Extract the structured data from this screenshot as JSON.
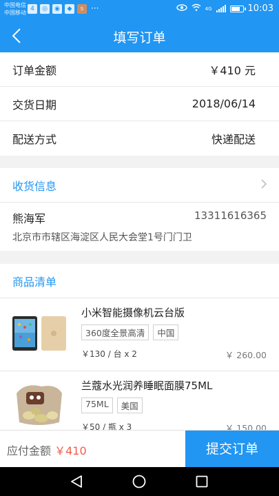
{
  "status_bar": {
    "carrier_line1": "中国电信",
    "carrier_line2": "中国移动",
    "network": "4G",
    "time": "10:03",
    "more": "···"
  },
  "nav": {
    "back_icon": "chevron-left-icon",
    "title": "填写订单"
  },
  "order": {
    "amount_label": "订单金额",
    "amount_value": "￥410 元",
    "date_label": "交货日期",
    "date_value": "2018/06/14",
    "delivery_label": "配送方式",
    "delivery_value": "快递配送"
  },
  "shipping": {
    "title": "收货信息",
    "name": "熊海军",
    "phone": "13311616365",
    "address": "北京市市辖区海淀区人民大会堂1号门门卫"
  },
  "goods": {
    "title": "商品清单",
    "items": [
      {
        "title": "小米智能摄像机云台版",
        "tags": [
          "360度全景高清",
          "中国"
        ],
        "unit": "￥130 / 台 x 2",
        "price": "￥ 260.00"
      },
      {
        "title": "兰蔻水光润养睡眠面膜75ML",
        "tags": [
          "75ML",
          "美国"
        ],
        "unit": "￥50 / 瓶 x 3",
        "price": "￥ 150.00"
      }
    ]
  },
  "footer": {
    "pay_label": "应付金额",
    "pay_amount": "￥410",
    "submit": "提交订单"
  },
  "colors": {
    "primary": "#2196f3",
    "price_red": "#f25b4a"
  }
}
